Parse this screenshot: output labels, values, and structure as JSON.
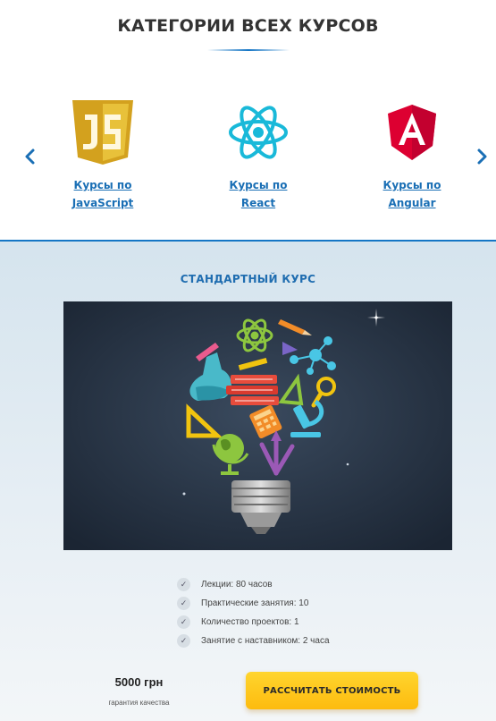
{
  "header": {
    "title": "КАТЕГОРИИ ВСЕХ КУРСОВ"
  },
  "carousel": {
    "prev_label": "‹",
    "next_label": "›",
    "items": [
      {
        "label_line1": "Курсы по",
        "label_line2": "JavaScript",
        "icon": "javascript-logo",
        "color": "#e8c13a"
      },
      {
        "label_line1": "Курсы по",
        "label_line2": "React",
        "icon": "react-logo",
        "color": "#19b9d9"
      },
      {
        "label_line1": "Курсы по",
        "label_line2": "Angular",
        "icon": "angular-logo",
        "color": "#dd0031"
      }
    ]
  },
  "course": {
    "title": "СТАНДАРТНЫЙ КУРС",
    "image": "lightbulb-science-illustration",
    "features": [
      "Лекции: 80 часов",
      "Практические занятия: 10",
      "Количество проектов: 1",
      "Занятие с наставником: 2 часа"
    ],
    "price": "5000 грн",
    "price_note": "гарантия качества",
    "cta_label": "РАССЧИТАТЬ СТОИМОСТЬ"
  },
  "colors": {
    "accent": "#1576c5",
    "link": "#1a6fb5",
    "cta": "#fdc51a"
  }
}
